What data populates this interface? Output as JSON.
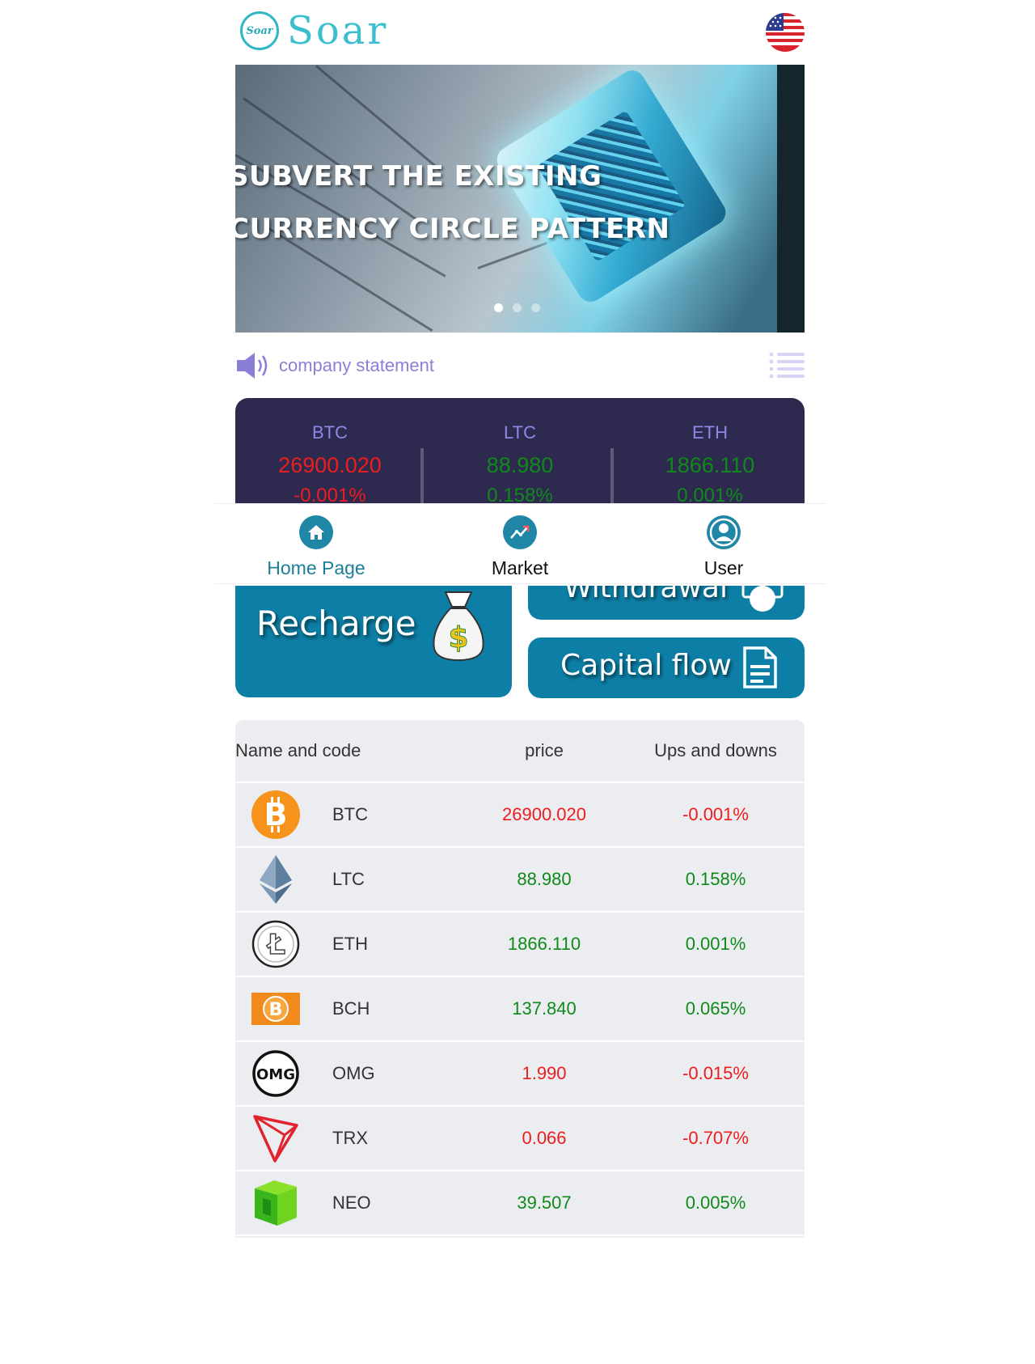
{
  "header": {
    "logo_badge": "Soar",
    "logo_text": "Soar",
    "language_flag_icon": "us-flag-icon"
  },
  "banner": {
    "line1": "SUBVERT THE EXISTING",
    "line2": "CURRENCY CIRCLE PATTERN",
    "slides": 3,
    "active_slide": 1
  },
  "notice": {
    "text": "company statement",
    "icon": "speaker-icon",
    "menu_icon": "list-icon"
  },
  "ticker": [
    {
      "name": "BTC",
      "price": "26900.020",
      "change": "-0.001%",
      "trend": "down"
    },
    {
      "name": "LTC",
      "price": "88.980",
      "change": "0.158%",
      "trend": "up"
    },
    {
      "name": "ETH",
      "price": "1866.110",
      "change": "0.001%",
      "trend": "up"
    }
  ],
  "nav": {
    "home": "Home Page",
    "market": "Market",
    "user": "User"
  },
  "actions": {
    "recharge": "Recharge",
    "withdrawal": "Withdrawal",
    "capital_flow": "Capital flow"
  },
  "table": {
    "headers": [
      "Name and code",
      "price",
      "Ups and downs"
    ],
    "rows": [
      {
        "code": "BTC",
        "price": "26900.020",
        "change": "-0.001%",
        "trend": "down",
        "icon": "bitcoin-icon"
      },
      {
        "code": "LTC",
        "price": "88.980",
        "change": "0.158%",
        "trend": "up",
        "icon": "ethereum-icon"
      },
      {
        "code": "ETH",
        "price": "1866.110",
        "change": "0.001%",
        "trend": "up",
        "icon": "litecoin-icon"
      },
      {
        "code": "BCH",
        "price": "137.840",
        "change": "0.065%",
        "trend": "up",
        "icon": "bitcoin-cash-icon"
      },
      {
        "code": "OMG",
        "price": "1.990",
        "change": "-0.015%",
        "trend": "down",
        "icon": "omg-icon"
      },
      {
        "code": "TRX",
        "price": "0.066",
        "change": "-0.707%",
        "trend": "down",
        "icon": "tron-icon"
      },
      {
        "code": "NEO",
        "price": "39.507",
        "change": "0.005%",
        "trend": "up",
        "icon": "neo-icon"
      }
    ]
  },
  "colors": {
    "accent": "#0d7fa6",
    "up": "#0f8a1a",
    "down": "#ee1d1d",
    "ticker_bg": "#2e2a4f",
    "logo": "#3bbfcf"
  }
}
